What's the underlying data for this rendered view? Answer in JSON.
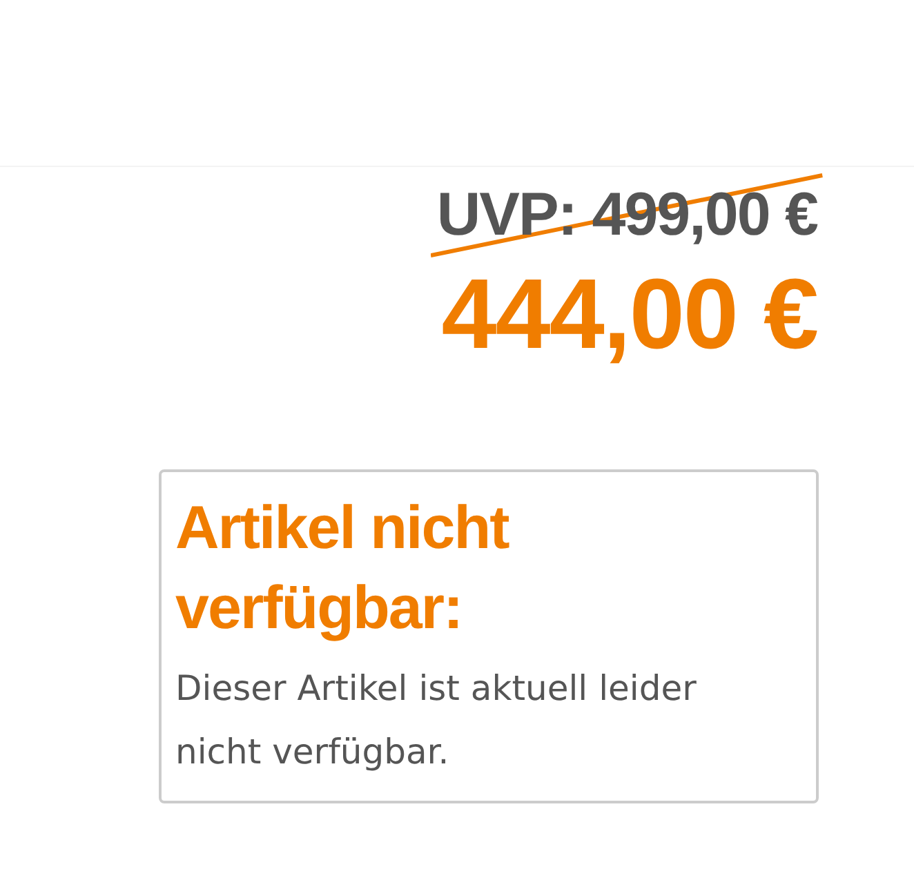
{
  "old_price": {
    "text": "UVP: 499,00 €",
    "strikethrough": true
  },
  "price": "444,00 €",
  "notice": {
    "title": "Artikel nicht verfügbar:",
    "text": "Dieser Artikel ist aktuell leider nicht verfügbar."
  }
}
